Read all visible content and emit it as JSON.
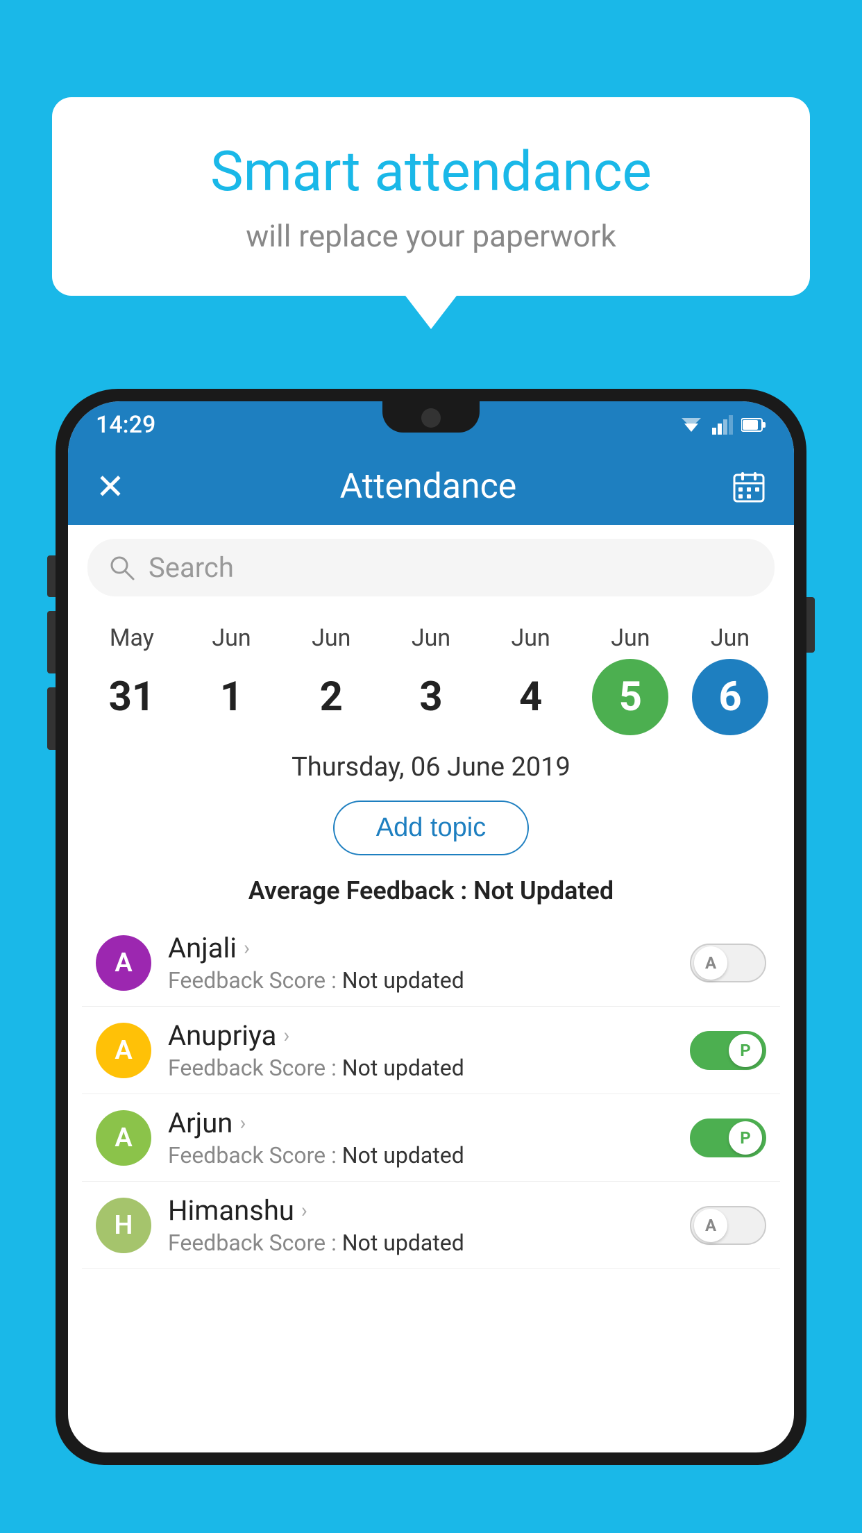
{
  "background": {
    "color": "#1ab8e8"
  },
  "speech_bubble": {
    "title": "Smart attendance",
    "subtitle": "will replace your paperwork"
  },
  "phone": {
    "status_bar": {
      "time": "14:29",
      "icons": [
        "wifi",
        "signal",
        "battery"
      ]
    },
    "app_bar": {
      "close_icon": "✕",
      "title": "Attendance",
      "calendar_icon": "calendar"
    },
    "search": {
      "placeholder": "Search"
    },
    "calendar": {
      "days": [
        {
          "month": "May",
          "date": "31",
          "state": "normal"
        },
        {
          "month": "Jun",
          "date": "1",
          "state": "normal"
        },
        {
          "month": "Jun",
          "date": "2",
          "state": "normal"
        },
        {
          "month": "Jun",
          "date": "3",
          "state": "normal"
        },
        {
          "month": "Jun",
          "date": "4",
          "state": "normal"
        },
        {
          "month": "Jun",
          "date": "5",
          "state": "today"
        },
        {
          "month": "Jun",
          "date": "6",
          "state": "selected"
        }
      ]
    },
    "selected_date": "Thursday, 06 June 2019",
    "add_topic_label": "Add topic",
    "avg_feedback_label": "Average Feedback :",
    "avg_feedback_value": "Not Updated",
    "students": [
      {
        "name": "Anjali",
        "avatar_letter": "A",
        "avatar_color": "#9c27b0",
        "feedback_label": "Feedback Score :",
        "feedback_value": "Not updated",
        "toggle": "off",
        "toggle_label": "A"
      },
      {
        "name": "Anupriya",
        "avatar_letter": "A",
        "avatar_color": "#ffc107",
        "feedback_label": "Feedback Score :",
        "feedback_value": "Not updated",
        "toggle": "on",
        "toggle_label": "P"
      },
      {
        "name": "Arjun",
        "avatar_letter": "A",
        "avatar_color": "#8bc34a",
        "feedback_label": "Feedback Score :",
        "feedback_value": "Not updated",
        "toggle": "on",
        "toggle_label": "P"
      },
      {
        "name": "Himanshu",
        "avatar_letter": "H",
        "avatar_color": "#a5c46c",
        "feedback_label": "Feedback Score :",
        "feedback_value": "Not updated",
        "toggle": "off",
        "toggle_label": "A"
      }
    ]
  }
}
